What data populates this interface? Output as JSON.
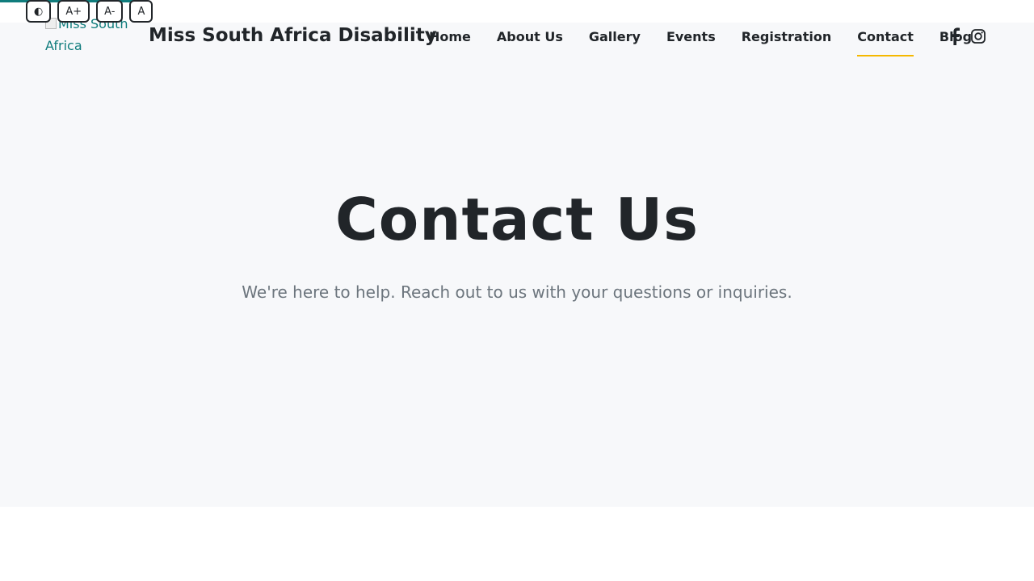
{
  "accessibility": {
    "buttons": [
      "◐",
      "A+",
      "A-",
      "A"
    ]
  },
  "header": {
    "logo_alt": "Miss South Africa",
    "brand_name": "Miss South Africa Disability",
    "nav": [
      {
        "label": "Home"
      },
      {
        "label": "About Us"
      },
      {
        "label": "Gallery"
      },
      {
        "label": "Events"
      },
      {
        "label": "Registration"
      },
      {
        "label": "Contact",
        "active": true
      },
      {
        "label": "Blog"
      }
    ],
    "social": [
      "facebook-icon",
      "instagram-icon"
    ]
  },
  "hero": {
    "title": "Contact Us",
    "subtitle": "We're here to help. Reach out to us with your questions or inquiries."
  },
  "colors": {
    "accent_teal": "#0f7c7c",
    "active_underline": "#f5b800",
    "hero_bg": "#f7f8fa",
    "text_dark": "#212529",
    "text_muted": "#6c757d"
  }
}
